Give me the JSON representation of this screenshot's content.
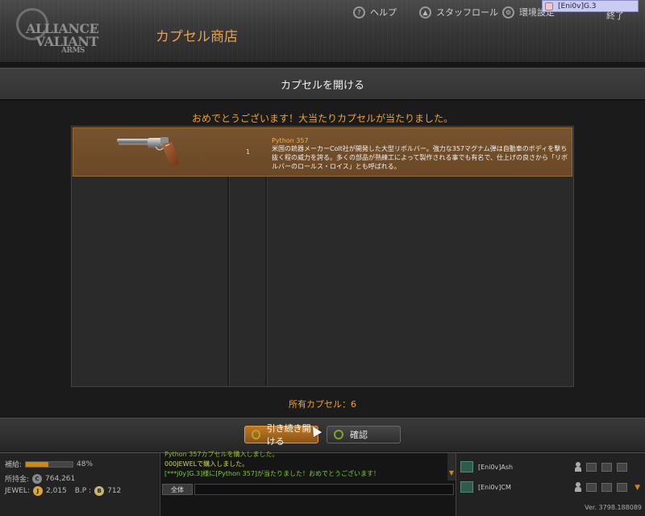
{
  "header": {
    "logo": {
      "line1": "ALLIANCE",
      "of": "of",
      "line2": "VALIANT",
      "line3": "ARMS"
    },
    "shop_title": "カプセル商店",
    "nav": {
      "help": "ヘルプ",
      "staff_roll": "スタッフロール",
      "settings": "環境設定",
      "close": "終了"
    },
    "user_chip": "[Eni0v]G.3"
  },
  "dialog": {
    "title": "カプセルを開ける",
    "congrats": "おめでとうございます！大当たりカプセルが当たりました。",
    "result": {
      "quantity": "1",
      "item_name": "Python 357",
      "description": "米国の銃器メーカーColt社が開発した大型リボルバー。強力な357マグナム弾は自動車のボディを撃ち抜く程の威力を誇る。多くの部品が熟練工によって製作される事でも有名で、仕上げの良さから「リボルバーのロールス・ロイス」とも呼ばれる。"
    },
    "capsule_count": "所有カプセル：6",
    "buttons": {
      "continue": "引き続き開ける",
      "confirm": "確認"
    }
  },
  "stats": {
    "supply_label": "補給:",
    "supply_percent": "48%",
    "supply_fraction": 0.48,
    "money_label": "所持金:",
    "money_icon": "C",
    "money": "764,261",
    "jewel_label": "JEWEL:",
    "jewel_icon": "J",
    "jewel": "2,015",
    "bp_label": "B.P :",
    "bp_icon": "B",
    "bp": "712"
  },
  "chat": {
    "lines": [
      "Python 357カプセルを購入しました。",
      "000JEWELで購入しました。",
      "[***j0y]G.3]様に[Python 357]が当たりました！おめでとうございます！"
    ],
    "tab": "全体"
  },
  "members": [
    {
      "name": "[Eni0v]Ash"
    },
    {
      "name": "[Eni0v]CM"
    }
  ],
  "version": "Ver. 3798.188089",
  "colors": {
    "accent_orange": "#f0a232",
    "highlight_row": "#77532e",
    "chat_green": "#7ecb3a"
  }
}
